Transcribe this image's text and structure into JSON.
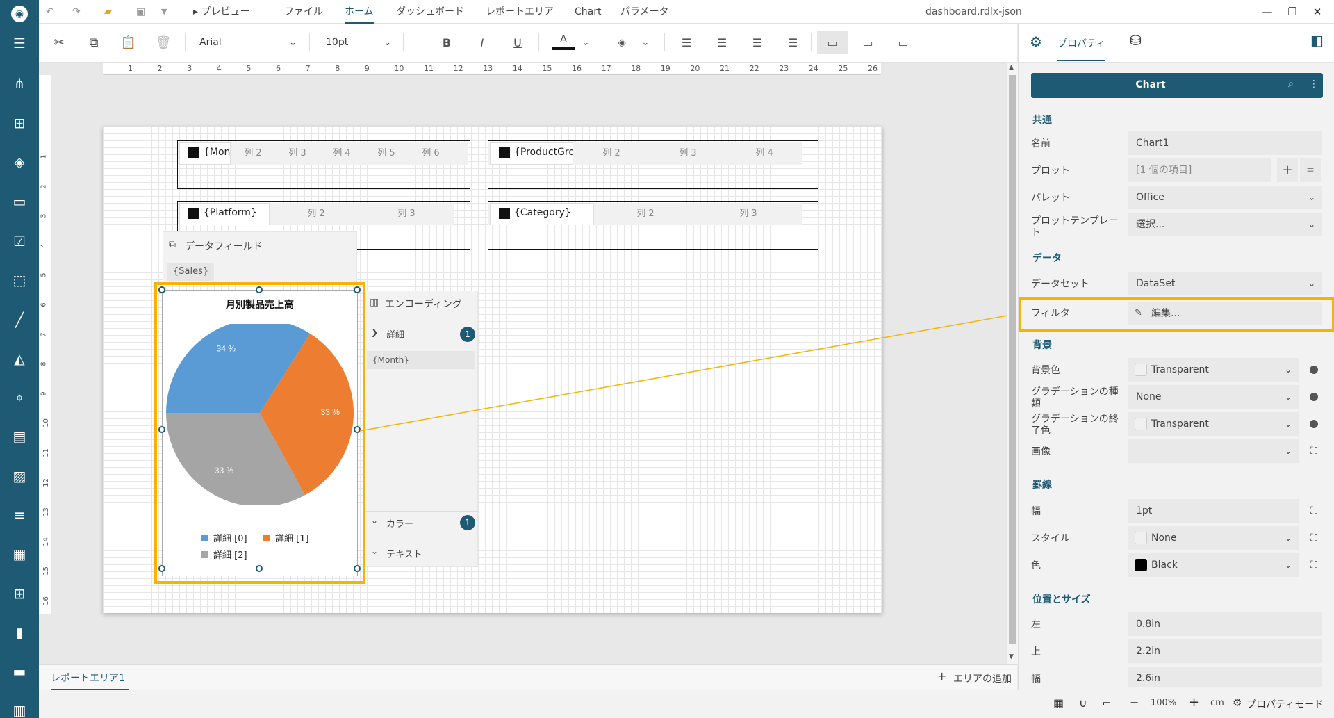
{
  "window": {
    "title": "dashboard.rdlx-json",
    "minimize_glyph": "—",
    "restore_glyph": "❐",
    "close_glyph": "✕"
  },
  "menu": {
    "preview_label": "プレビュー",
    "items": [
      "ファイル",
      "ホーム",
      "ダッシュボード",
      "レポートエリア",
      "Chart",
      "パラメータ"
    ],
    "active_index": 1
  },
  "toolbar": {
    "font_family": "Arial",
    "font_size": "10pt",
    "bold_glyph": "B",
    "italic_glyph": "I",
    "underline_glyph": "U",
    "font_color_glyph": "A"
  },
  "ruler": {
    "h_ticks": [
      "1",
      "2",
      "3",
      "4",
      "5",
      "6",
      "7",
      "8",
      "9",
      "10",
      "11",
      "12",
      "13",
      "14",
      "15",
      "16",
      "17",
      "18",
      "19",
      "20",
      "21",
      "22",
      "23",
      "24",
      "25",
      "26"
    ],
    "v_ticks": [
      "1",
      "2",
      "3",
      "4",
      "5",
      "6",
      "7",
      "8",
      "9",
      "10",
      "11",
      "12",
      "13",
      "14",
      "15",
      "16"
    ]
  },
  "tables": [
    {
      "first": "{Month}",
      "cols": [
        "列 2",
        "列 3",
        "列 4",
        "列 5",
        "列 6"
      ]
    },
    {
      "first": "{ProductGro",
      "cols": [
        "列 2",
        "列 3",
        "列 4"
      ]
    },
    {
      "first": "{Platform}",
      "cols": [
        "列 2",
        "列 3"
      ]
    },
    {
      "first": "{Category}",
      "cols": [
        "列 2",
        "列 3"
      ]
    }
  ],
  "data_field_panel": {
    "title": "データフィールド",
    "value": "{Sales}"
  },
  "encoding_panel": {
    "title": "エンコーディング",
    "details_label": "詳細",
    "details_count": "1",
    "details_value": "{Month}",
    "color_label": "カラー",
    "color_count": "1",
    "text_label": "テキスト"
  },
  "chart": {
    "title": "月別製品売上高",
    "slice_labels": [
      "34 %",
      "33 %",
      "33 %"
    ],
    "legend": [
      "詳細 [0]",
      "詳細 [1]",
      "詳細 [2]"
    ],
    "colors": [
      "#5b9bd5",
      "#ed7d31",
      "#a5a5a5"
    ]
  },
  "chart_data": {
    "type": "pie",
    "title": "月別製品売上高",
    "categories": [
      "詳細 [0]",
      "詳細 [1]",
      "詳細 [2]"
    ],
    "values": [
      34,
      33,
      33
    ],
    "legend": "bottom"
  },
  "tabs": {
    "report_area": "レポートエリア1",
    "add_area": "エリアの追加"
  },
  "status": {
    "zoom": "100%",
    "unit": "cm",
    "property_mode": "プロパティモード"
  },
  "properties": {
    "tab_label": "プロパティ",
    "header": "Chart",
    "sections": {
      "common": "共通",
      "data": "データ",
      "background": "背景",
      "border": "罫線",
      "position": "位置とサイズ"
    },
    "name_label": "名前",
    "name_value": "Chart1",
    "plot_label": "プロット",
    "plot_value": "[1 個の項目]",
    "palette_label": "パレット",
    "palette_value": "Office",
    "plot_template_label": "プロットテンプレート",
    "plot_template_value": "選択...",
    "dataset_label": "データセット",
    "dataset_value": "DataSet",
    "filter_label": "フィルタ",
    "filter_value": "編集...",
    "bg_color_label": "背景色",
    "bg_color_value": "Transparent",
    "gradient_type_label": "グラデーションの種類",
    "gradient_type_value": "None",
    "gradient_end_label": "グラデーションの終了色",
    "gradient_end_value": "Transparent",
    "image_label": "画像",
    "image_value": "",
    "border_width_label": "幅",
    "border_width_value": "1pt",
    "border_style_label": "スタイル",
    "border_style_value": "None",
    "border_color_label": "色",
    "border_color_value": "Black",
    "left_label": "左",
    "left_value": "0.8in",
    "top_label": "上",
    "top_value": "2.2in",
    "width_label": "幅",
    "width_value": "2.6in"
  },
  "accent_color": "#1e5a73",
  "highlight_color": "#f5b400"
}
